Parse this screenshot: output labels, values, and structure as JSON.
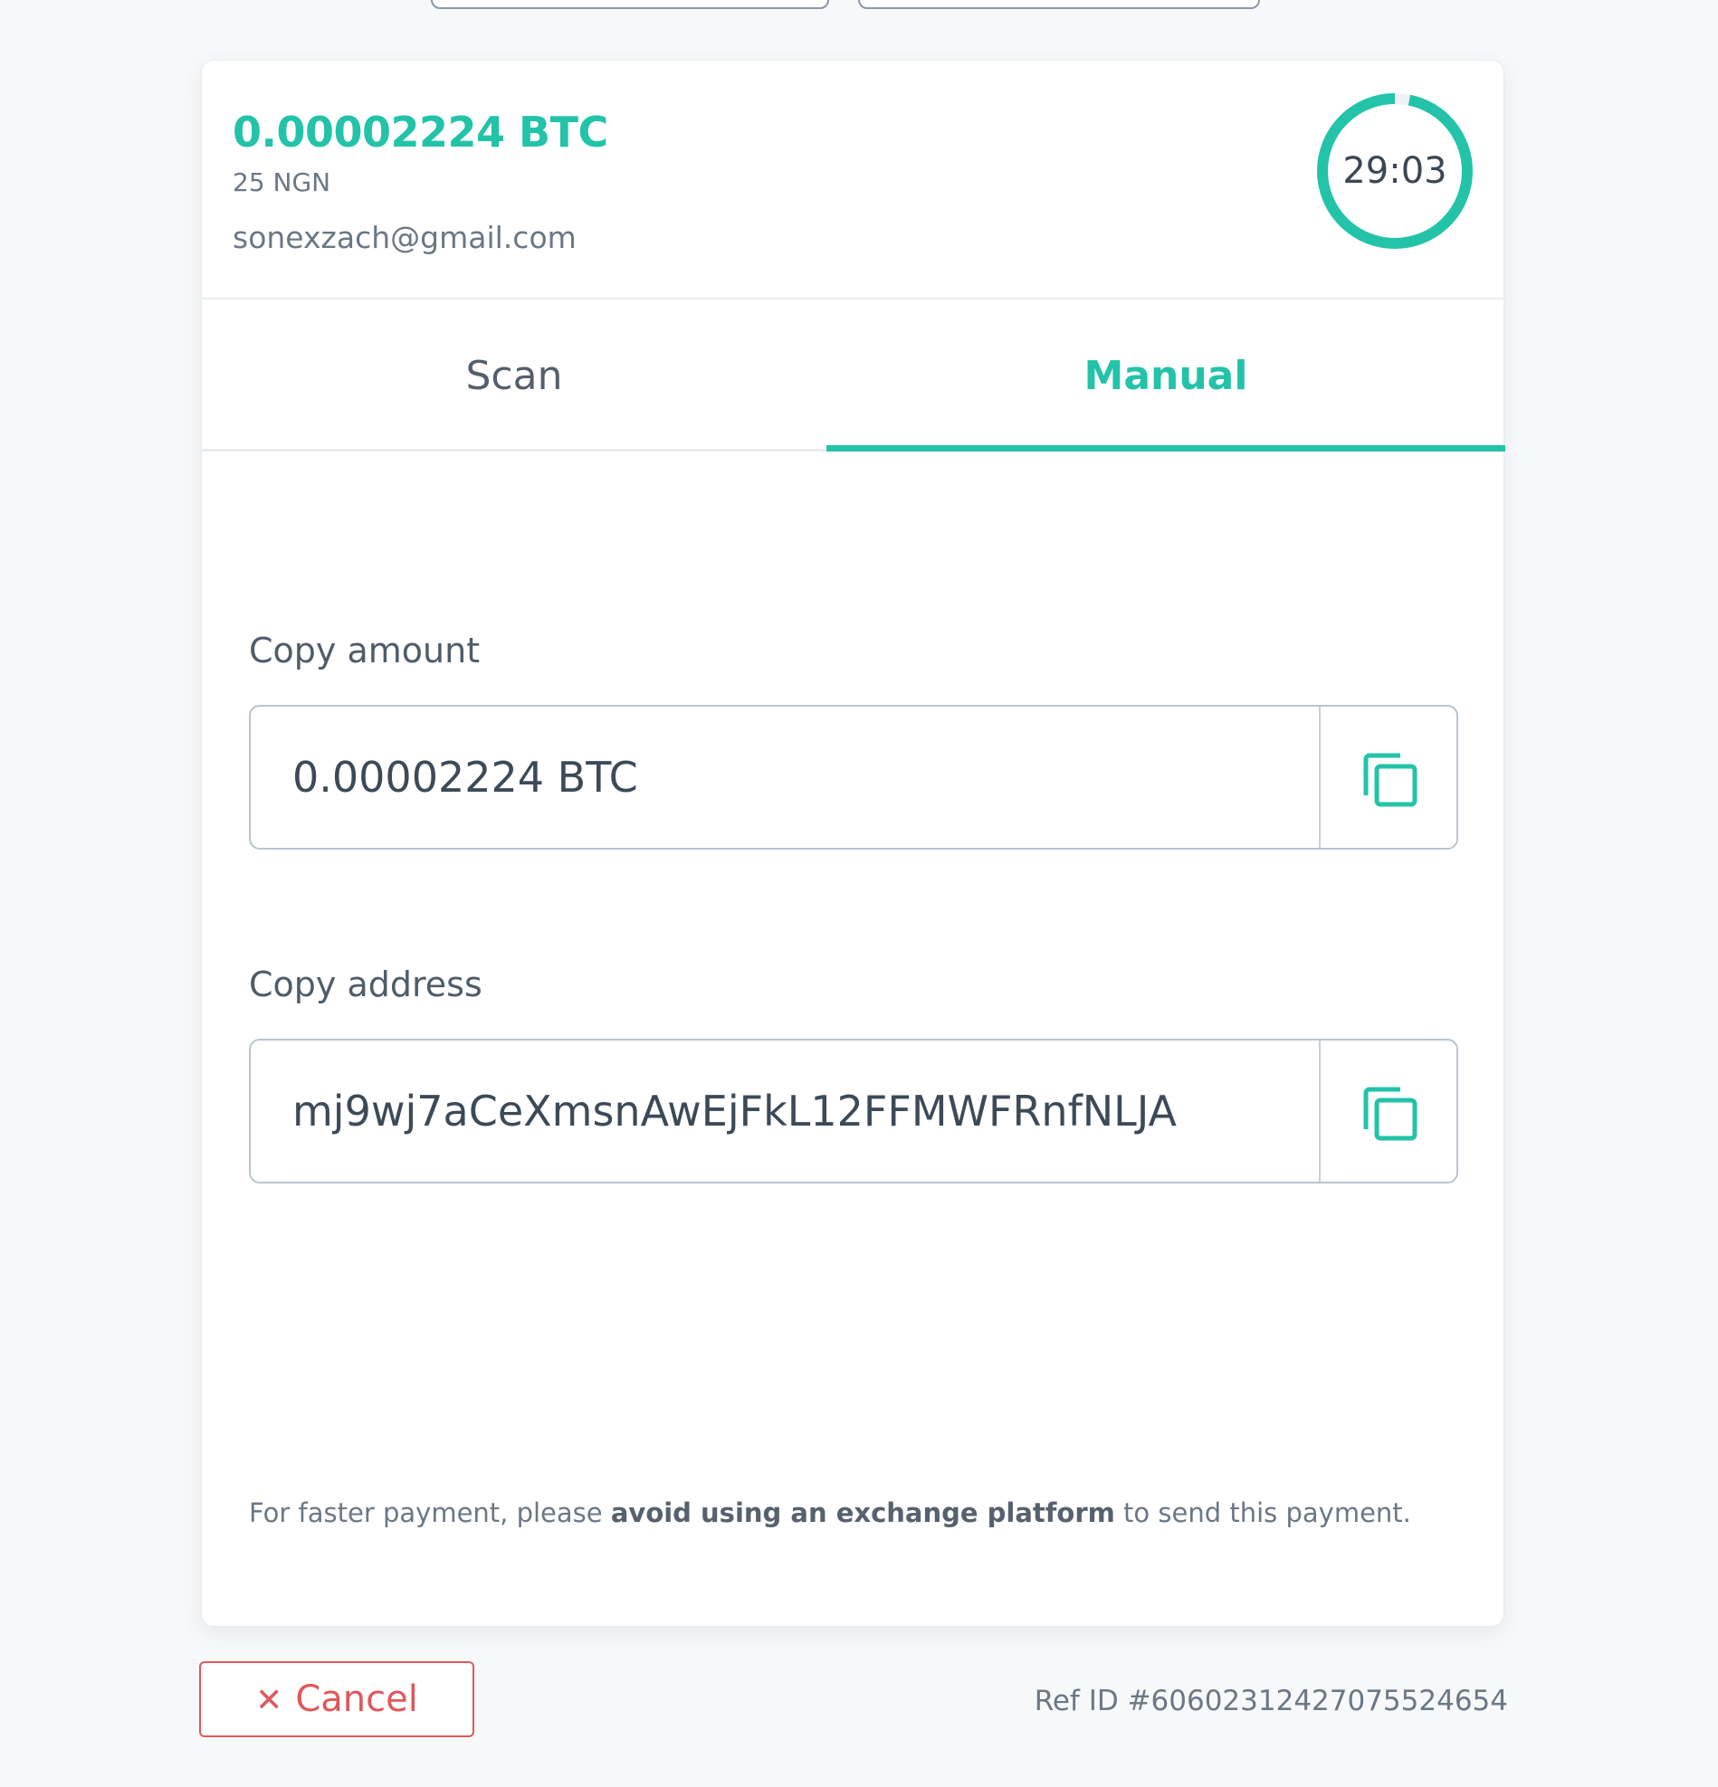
{
  "payment": {
    "crypto_amount": "0.00002224 BTC",
    "fiat_amount": "25 NGN",
    "email": "sonexzach@gmail.com",
    "timer": "29:03",
    "timer_remaining_fraction": 0.968
  },
  "tabs": [
    {
      "label": "Scan",
      "active": false
    },
    {
      "label": "Manual",
      "active": true
    }
  ],
  "manual": {
    "amount_label": "Copy amount",
    "amount_value": "0.00002224 BTC",
    "address_label": "Copy address",
    "address_value": "mj9wj7aCeXmsnAwEjFkL12FFMWFRnfNLJA"
  },
  "notice": {
    "prefix": "For faster payment, please ",
    "emphasis": "avoid using an exchange platform",
    "suffix": " to send this payment."
  },
  "footer": {
    "cancel_label": "Cancel",
    "ref_id": "Ref ID #6060231242707552465​4"
  },
  "colors": {
    "accent": "#22c3a9",
    "danger": "#e0575a"
  },
  "icons": {
    "copy": "copy-icon",
    "cancel": "close-icon"
  }
}
